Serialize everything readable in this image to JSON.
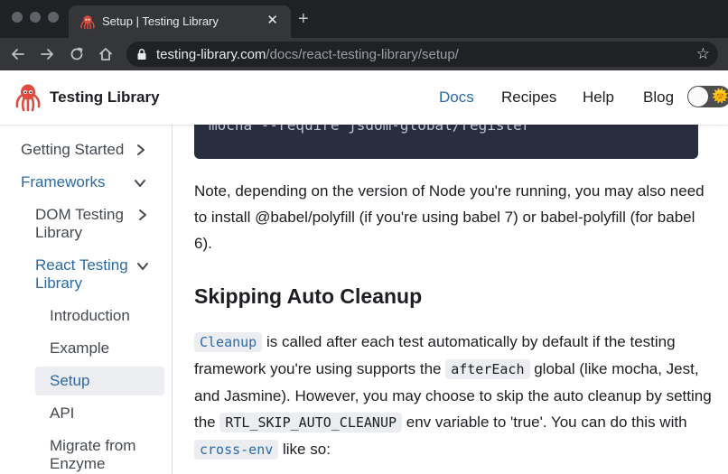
{
  "browser": {
    "tab_title": "Setup | Testing Library",
    "tab_close": "✕",
    "new_tab": "+",
    "url_host": "testing-library.com",
    "url_path": "/docs/react-testing-library/setup/",
    "bookmark_icon": "☆"
  },
  "header": {
    "brand": "Testing Library",
    "nav": [
      "Docs",
      "Recipes",
      "Help",
      "Blog"
    ],
    "active_nav": "Docs",
    "toggle_icon": "🌞"
  },
  "sidebar": {
    "getting_started": "Getting Started",
    "frameworks": "Frameworks",
    "dom_testing": [
      "DOM Testing",
      "Library"
    ],
    "react_testing": [
      "React Testing",
      "Library"
    ],
    "introduction": "Introduction",
    "example": "Example",
    "setup": "Setup",
    "api": "API",
    "migrate": [
      "Migrate from",
      "Enzyme"
    ]
  },
  "content": {
    "code_line": "mocha --require jsdom-global/register",
    "note": "Note, depending on the version of Node you're running, you may also need to install @babel/polyfill (if you're using babel 7) or babel-polyfill (for babel 6).",
    "heading": "Skipping Auto Cleanup",
    "p2": {
      "cleanup": "Cleanup",
      "t1": " is called after each test automatically by default if the testing framework you're using supports the ",
      "after_each": "afterEach",
      "t2": " global (like mocha, Jest, and Jasmine). However, you may choose to skip the auto cleanup by setting the ",
      "env_var": "RTL_SKIP_AUTO_CLEANUP",
      "t3": " env variable to 'true'. You can do this with ",
      "cross_env": "cross-env",
      "t4": " like so:"
    }
  },
  "colors": {
    "link": "#2b6aa8",
    "chrome_bg": "#202124",
    "toolbar_bg": "#35363a",
    "code_bg": "#292d3e",
    "inline_code_bg": "#ebedf0",
    "octopus": "#e04b40"
  },
  "icons": [
    "octopus-logo-icon",
    "lock-icon",
    "back-arrow-icon",
    "forward-arrow-icon",
    "reload-icon",
    "home-icon",
    "star-icon",
    "chevron-right-icon",
    "chevron-down-icon",
    "sun-icon"
  ]
}
